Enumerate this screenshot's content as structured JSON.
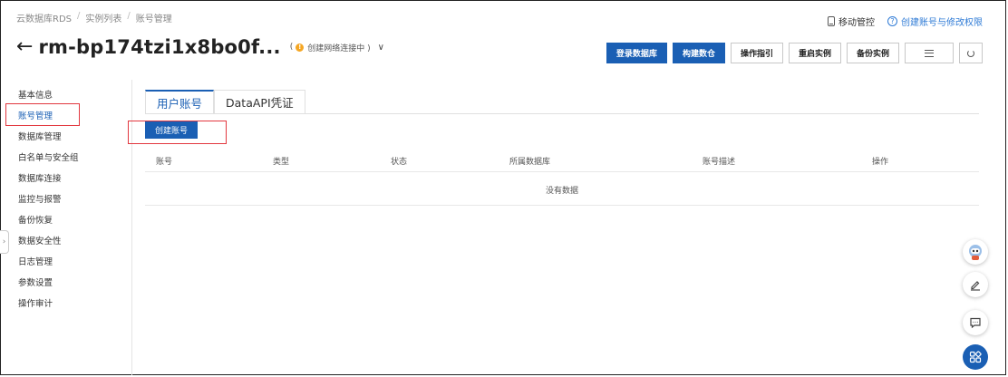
{
  "breadcrumb": [
    "云数据库RDS",
    "实例列表",
    "账号管理"
  ],
  "top_links": {
    "mobile": "移动管控",
    "help": "创建账号与修改权限"
  },
  "header": {
    "back_icon": "back-arrow-icon",
    "instance_name": "rm-bp174tzi1x8bo0f...",
    "status": "创建网络连接中 )"
  },
  "actions": [
    "登录数据库",
    "构建数仓",
    "操作指引",
    "重启实例",
    "备份实例"
  ],
  "sidebar": {
    "items": [
      "基本信息",
      "账号管理",
      "数据库管理",
      "白名单与安全组",
      "数据库连接",
      "监控与报警",
      "备份恢复",
      "数据安全性",
      "日志管理",
      "参数设置",
      "操作审计"
    ],
    "active_index": 1
  },
  "tabs": [
    "用户账号",
    "DataAPI凭证"
  ],
  "create_button": "创建账号",
  "table": {
    "headers": [
      "账号",
      "类型",
      "状态",
      "所属数据库",
      "账号描述",
      "操作"
    ],
    "empty_text": "没有数据"
  },
  "colors": {
    "primary": "#1a5fb4",
    "highlight": "#e2383f",
    "status": "#f5a623"
  }
}
